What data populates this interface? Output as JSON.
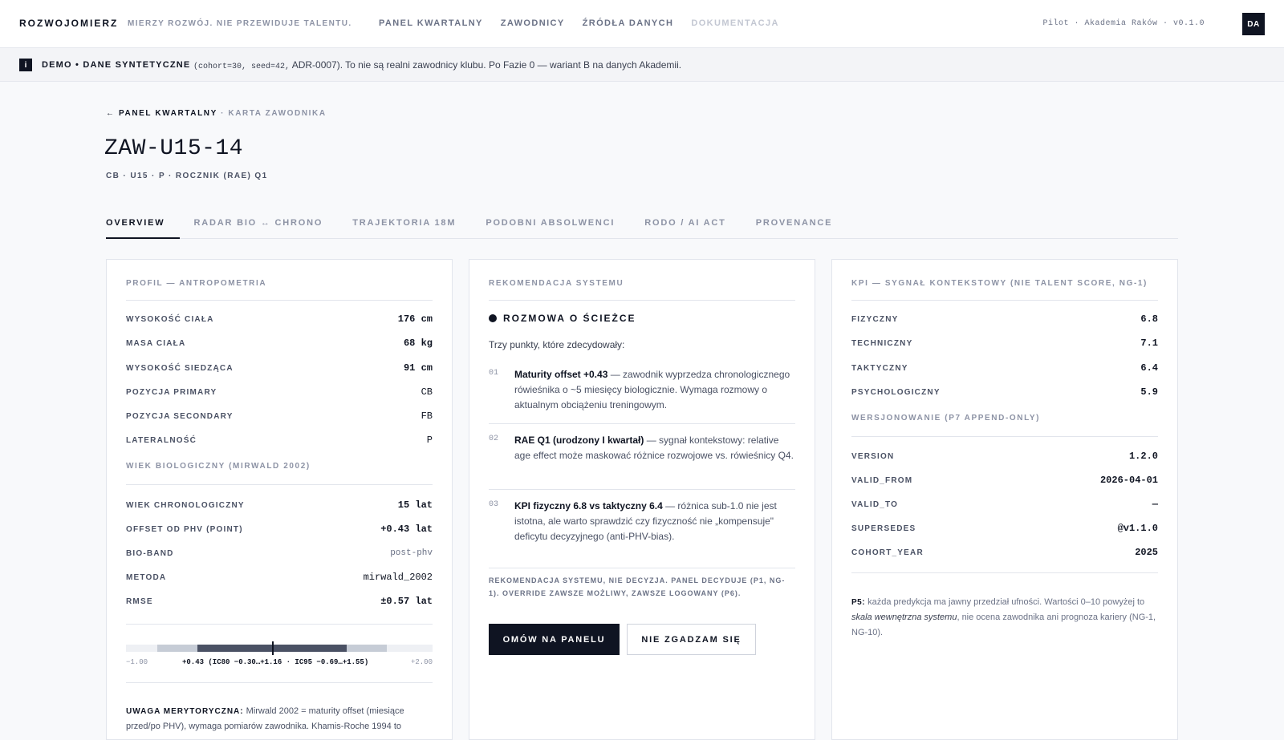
{
  "topbar": {
    "brand": "ROZWOJOMIERZ",
    "tagline": "MIERZY ROZWÓJ. NIE PRZEWIDUJE TALENTU.",
    "nav": [
      "PANEL KWARTALNY",
      "ZAWODNICY",
      "ŹRÓDŁA DANYCH",
      "DOKUMENTACJA"
    ],
    "meta": "Pilot · Akademia Raków · v0.1.0",
    "avatar": "DA"
  },
  "banner": {
    "icon": "i",
    "strong": "DEMO • DANE SYNTETYCZNE",
    "code": "(cohort=30, seed=42,",
    "text": "ADR-0007). To nie są realni zawodnicy klubu. Po Fazie 0 — wariant B na danych Akademii."
  },
  "header": {
    "crumb_back": "← PANEL KWARTALNY",
    "crumb_sep": " · ",
    "crumb_current": "KARTA ZAWODNIKA",
    "player_id": "ZAW-U15-14",
    "subline": "CB · U15 · P · ROCZNIK (RAE) Q1"
  },
  "tabs": [
    "OVERVIEW",
    "RADAR BIO ↔ CHRONO",
    "TRAJEKTORIA 18M",
    "PODOBNI ABSOLWENCI",
    "RODO / AI ACT",
    "PROVENANCE"
  ],
  "profile": {
    "title": "PROFIL — ANTROPOMETRIA",
    "rows": [
      {
        "k": "WYSOKOŚĆ CIAŁA",
        "v": "176 cm"
      },
      {
        "k": "MASA CIAŁA",
        "v": "68 kg"
      },
      {
        "k": "WYSOKOŚĆ SIEDZĄCA",
        "v": "91 cm"
      },
      {
        "k": "POZYCJA PRIMARY",
        "v": "CB"
      },
      {
        "k": "POZYCJA SECONDARY",
        "v": "FB"
      },
      {
        "k": "LATERALNOŚĆ",
        "v": "P"
      }
    ],
    "bio_title": "WIEK BIOLOGICZNY (MIRWALD 2002)",
    "bio_rows": [
      {
        "k": "WIEK CHRONOLOGICZNY",
        "v": "15 lat"
      },
      {
        "k": "OFFSET OD PHV (POINT)",
        "v": "+0.43 lat"
      },
      {
        "k": "BIO-BAND",
        "v": "post-phv"
      },
      {
        "k": "METODA",
        "v": "mirwald_2002"
      },
      {
        "k": "RMSE",
        "v": "±0.57 lat"
      }
    ],
    "ci": {
      "min": -1.0,
      "max": 2.0,
      "point": 0.43,
      "ci80": [
        -0.3,
        1.16
      ],
      "ci95": [
        -0.69,
        1.55
      ],
      "min_label": "−1.00",
      "max_label": "+2.00",
      "label": "+0.43 (IC80 −0.30…+1.16 · IC95 −0.69…+1.55)"
    },
    "note_label": "UWAGA MERYTORYCZNA:",
    "note_text": "Mirwald 2002 = maturity offset (miesiące przed/po PHV), wymaga pomiarów zawodnika. Khamis-Roche 1994 to"
  },
  "recommendation": {
    "title": "REKOMENDACJA SYSTEMU",
    "heading": "ROZMOWA O ŚCIEŻCE",
    "intro": "Trzy punkty, które zdecydowały:",
    "reasons": [
      {
        "num": "01",
        "bold": "Maturity offset +0.43",
        "text": " — zawodnik wyprzedza chronologicznego rówieśnika o ~5 miesięcy biologicznie. Wymaga rozmowy o aktualnym obciążeniu treningowym."
      },
      {
        "num": "02",
        "bold": "RAE Q1 (urodzony I kwartał)",
        "text": " — sygnał kontekstowy: relative age effect może maskować różnice rozwojowe vs. rówieśnicy Q4."
      },
      {
        "num": "03",
        "bold": "KPI fizyczny 6.8 vs taktyczny 6.4",
        "text": " — różnica sub-1.0 nie jest istotna, ale warto sprawdzić czy fizyczność nie „kompensuje\" deficytu decyzyjnego (anti-PHV-bias)."
      }
    ],
    "disclaimer": "REKOMENDACJA SYSTEMU, NIE DECYZJA. PANEL DECYDUJE (P1, NG-1). OVERRIDE ZAWSZE MOŻLIWY, ZAWSZE LOGOWANY (P6).",
    "primary_btn": "OMÓW NA PANELU",
    "secondary_btn": "NIE ZGADZAM SIĘ"
  },
  "kpi": {
    "title": "KPI — SYGNAŁ KONTEKSTOWY (NIE TALENT SCORE, NG-1)",
    "rows": [
      {
        "k": "FIZYCZNY",
        "v": "6.8"
      },
      {
        "k": "TECHNICZNY",
        "v": "7.1"
      },
      {
        "k": "TAKTYCZNY",
        "v": "6.4"
      },
      {
        "k": "PSYCHOLOGICZNY",
        "v": "5.9"
      }
    ],
    "ver_title": "WERSJONOWANIE (P7 APPEND-ONLY)",
    "ver_rows": [
      {
        "k": "VERSION",
        "v": "1.2.0"
      },
      {
        "k": "VALID_FROM",
        "v": "2026-04-01"
      },
      {
        "k": "VALID_TO",
        "v": "—"
      },
      {
        "k": "SUPERSEDES",
        "v": "@v1.1.0"
      },
      {
        "k": "COHORT_YEAR",
        "v": "2025"
      }
    ],
    "p5_label": "P5:",
    "p5_a": " każda predykcja ma jawny przedział ufności. Wartości 0–10 powyżej to ",
    "p5_i": "skala wewnętrzna systemu",
    "p5_b": ", nie ocena zawodnika ani prognoza kariery (NG-1, NG-10)."
  }
}
